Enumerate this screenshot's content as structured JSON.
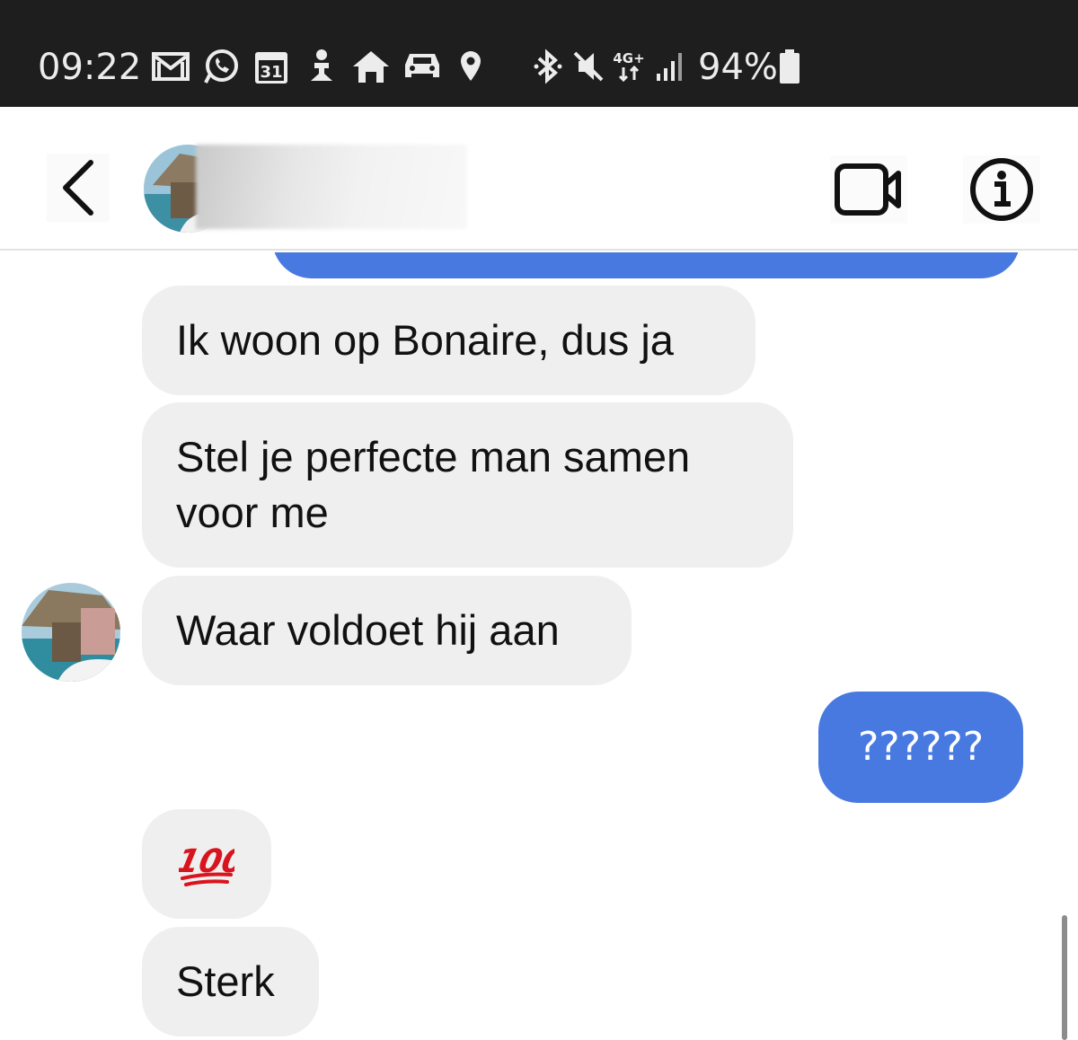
{
  "status_bar": {
    "time": "09:22",
    "battery": "94%",
    "network": "4G+",
    "calendar_day": "31",
    "icons": [
      "gmail-icon",
      "whatsapp-icon",
      "calendar-icon",
      "person-icon",
      "home-icon",
      "car-icon",
      "location-icon",
      "bluetooth-icon",
      "mute-icon",
      "signal-icon",
      "battery-icon"
    ]
  },
  "header": {
    "contact_name": "",
    "back_icon": "chevron-left-icon",
    "video_icon": "video-call-icon",
    "info_icon": "info-icon"
  },
  "messages": [
    {
      "side": "in",
      "text": "Ik woon op Bonaire, dus ja"
    },
    {
      "side": "in",
      "text": "Stel je perfecte man samen voor me"
    },
    {
      "side": "in",
      "text": "Waar voldoet hij aan"
    },
    {
      "side": "out",
      "text": "??????"
    },
    {
      "side": "in",
      "text": "💯"
    },
    {
      "side": "in",
      "text": "Sterk"
    }
  ],
  "colors": {
    "outgoing_bubble": "#4879e0",
    "incoming_bubble": "#efefef",
    "status_bar_bg": "#1e1e1e",
    "emoji_red": "#d9141e"
  }
}
